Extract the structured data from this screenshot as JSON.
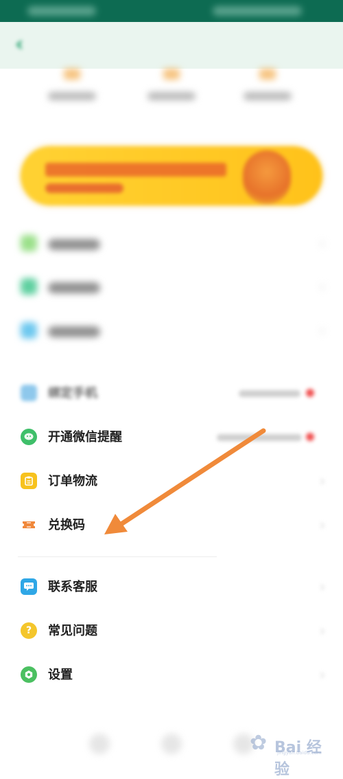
{
  "menu_bottom": [
    {
      "label": "开通微信提醒",
      "icon": "wechat-icon",
      "color": "#3fbf6a"
    },
    {
      "label": "订单物流",
      "icon": "clipboard-icon",
      "color": "#f7c21d"
    },
    {
      "label": "兑换码",
      "icon": "ticket-icon",
      "color": "#f0883b"
    },
    {
      "label": "联系客服",
      "icon": "chat-icon",
      "color": "#2fa7e6"
    },
    {
      "label": "常见问题",
      "icon": "question-icon",
      "color": "#f4c62c"
    },
    {
      "label": "设置",
      "icon": "settings-icon",
      "color": "#4bc061"
    }
  ],
  "blurred_row": {
    "label": "绑定手机"
  },
  "colors": {
    "status_bar": "#0d6b52",
    "header_bg": "#eaf5ef",
    "accent_green": "#1a9d67",
    "banner_yellow": "#ffd233",
    "annotation_arrow": "#f08a3a"
  },
  "watermark": {
    "text": "Bai 经验",
    "url": "jingyan.baidu.com"
  }
}
